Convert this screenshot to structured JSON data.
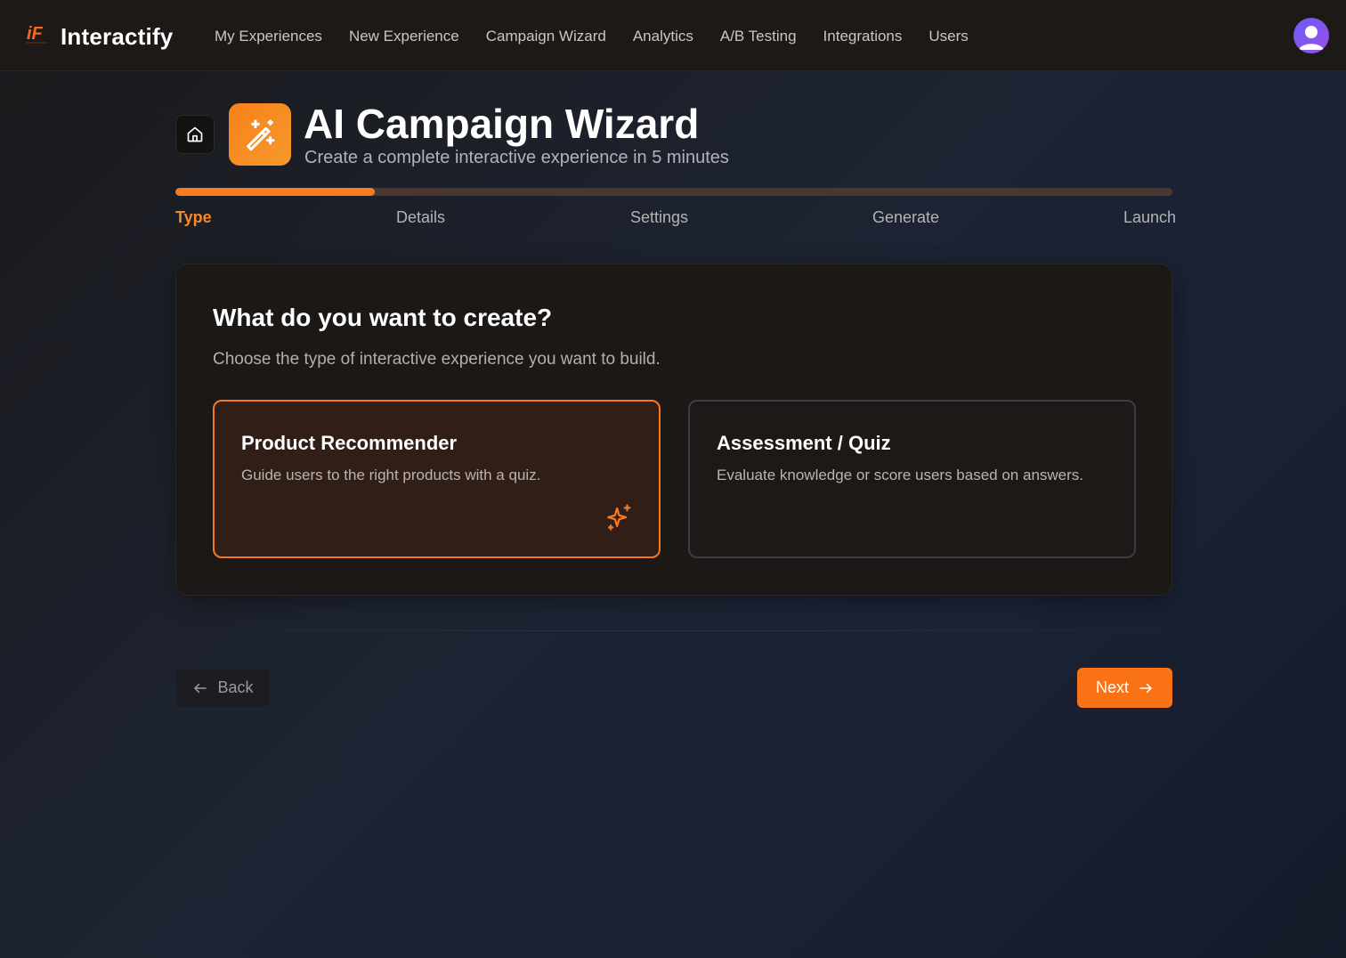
{
  "app": {
    "brand": "Interactify",
    "logo_text": "iF",
    "accent_color": "#f97316"
  },
  "nav": {
    "items": [
      {
        "label": "My Experiences"
      },
      {
        "label": "New Experience"
      },
      {
        "label": "Campaign Wizard"
      },
      {
        "label": "Analytics"
      },
      {
        "label": "A/B Testing"
      },
      {
        "label": "Integrations"
      },
      {
        "label": "Users"
      }
    ],
    "avatar_icon": "user-avatar-icon"
  },
  "header": {
    "home_icon": "home-icon",
    "wizard_icon": "magic-wand-icon",
    "title": "AI Campaign Wizard",
    "subtitle": "Create a complete interactive experience in 5 minutes"
  },
  "progress": {
    "current_step": 1,
    "total_steps": 5,
    "fraction": 0.2,
    "steps": [
      {
        "label": "Type",
        "active": true
      },
      {
        "label": "Details",
        "active": false
      },
      {
        "label": "Settings",
        "active": false
      },
      {
        "label": "Generate",
        "active": false
      },
      {
        "label": "Launch",
        "active": false
      }
    ]
  },
  "card": {
    "title": "What do you want to create?",
    "description": "Choose the type of interactive experience you want to build.",
    "options": [
      {
        "title": "Product Recommender",
        "description": "Guide users to the right products with a quiz.",
        "selected": true,
        "icon": "sparkles-icon"
      },
      {
        "title": "Assessment / Quiz",
        "description": "Evaluate knowledge or score users based on answers.",
        "selected": false
      }
    ]
  },
  "footer": {
    "back_label": "Back",
    "next_label": "Next",
    "back_icon": "arrow-left-icon",
    "next_icon": "arrow-right-icon"
  }
}
